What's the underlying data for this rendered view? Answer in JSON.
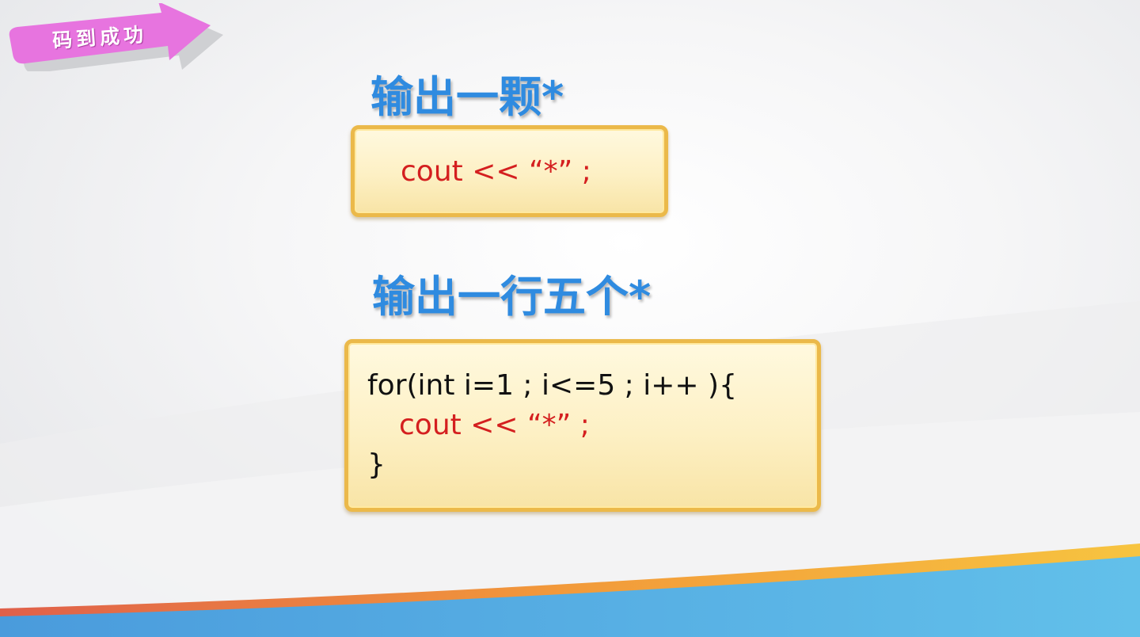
{
  "badge": {
    "label": "码到成功"
  },
  "section1": {
    "heading": "输出一颗*",
    "code": [
      "cout << “*” ;"
    ]
  },
  "section2": {
    "heading": "输出一行五个*",
    "code": [
      "for(int i=1 ; i<=5 ; i++ ){",
      "cout << “*” ;",
      "}"
    ]
  },
  "colors": {
    "heading": "#2f8be0",
    "code_keyword": "#d41f1f",
    "code_default": "#111111",
    "box_border": "#ebb94a",
    "badge": "#e774df"
  }
}
